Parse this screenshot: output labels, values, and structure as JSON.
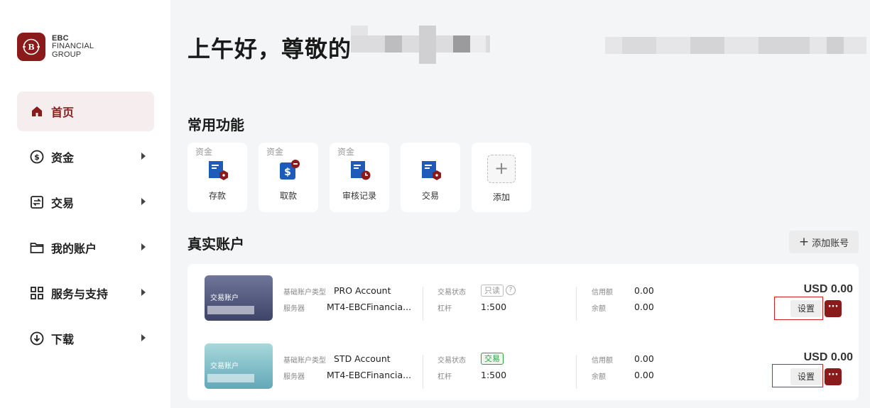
{
  "brand": {
    "line1": "EBC",
    "line2": "FINANCIAL",
    "line3": "GROUP",
    "color": "#8b1a1a"
  },
  "sidebar": {
    "items": [
      {
        "label": "首页",
        "icon": "home-icon",
        "active": true
      },
      {
        "label": "资金",
        "icon": "dollar-circle-icon"
      },
      {
        "label": "交易",
        "icon": "exchange-icon"
      },
      {
        "label": "我的账户",
        "icon": "folder-icon"
      },
      {
        "label": "服务与支持",
        "icon": "grid-icon"
      },
      {
        "label": "下载",
        "icon": "download-icon"
      }
    ]
  },
  "greeting": "上午好，尊敬的",
  "quick": {
    "title": "常用功能",
    "items": [
      {
        "tag": "资金",
        "label": "存款",
        "icon": "deposit-icon"
      },
      {
        "tag": "资金",
        "label": "取款",
        "icon": "withdraw-icon"
      },
      {
        "tag": "资金",
        "label": "审核记录",
        "icon": "audit-record-icon"
      },
      {
        "tag": "",
        "label": "交易",
        "icon": "trade-icon"
      },
      {
        "tag": "",
        "label": "添加",
        "icon": "plus-icon"
      }
    ]
  },
  "real_accounts": {
    "title": "真实账户",
    "add_label": "添加账号",
    "labels": {
      "type": "基础账户类型",
      "server": "服务器",
      "status": "交易状态",
      "leverage": "杠杆",
      "credit": "信用额",
      "balance": "余额",
      "thumb": "交易账户",
      "settings": "设置",
      "more": "···"
    },
    "accounts": [
      {
        "type": "PRO Account",
        "server": "MT4-EBCFinancia...",
        "status": "只读",
        "leverage": "1:500",
        "credit": "0.00",
        "balance": "0.00",
        "amount": "USD 0.00"
      },
      {
        "type": "STD Account",
        "server": "MT4-EBCFinancia...",
        "status": "交易",
        "leverage": "1:500",
        "credit": "0.00",
        "balance": "0.00",
        "amount": "USD 0.00"
      }
    ]
  }
}
